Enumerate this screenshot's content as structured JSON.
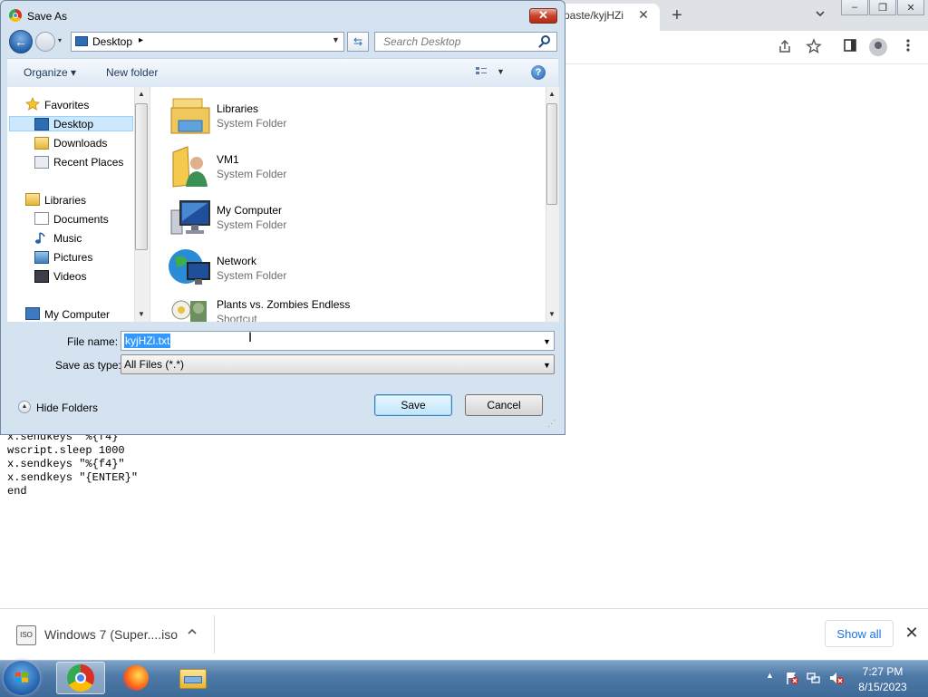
{
  "browser": {
    "tab_title": "paste/kyjHZi",
    "tab_close": "✕",
    "new_tab": "+",
    "window_buttons": [
      "–",
      "❐",
      "✕"
    ]
  },
  "page": {
    "code_lines": [
      "x.sendkeys \"%{f4}\"",
      "wscript.sleep 1000",
      "x.sendkeys \"%{f4}\"",
      "x.sendkeys \"{ENTER}\"",
      "end"
    ]
  },
  "download_shelf": {
    "item_icon_text": "ISO",
    "item_name": "Windows 7 (Super....iso",
    "show_all": "Show all",
    "close": "✕"
  },
  "dialog": {
    "title": "Save As",
    "close": "✕",
    "address": {
      "location": "Desktop",
      "separator": "▸"
    },
    "search_placeholder": "Search Desktop",
    "toolbar": {
      "organize": "Organize ▾",
      "new_folder": "New folder",
      "help": "?"
    },
    "nav": {
      "favorites": "Favorites",
      "favorites_items": [
        "Desktop",
        "Downloads",
        "Recent Places"
      ],
      "libraries": "Libraries",
      "libraries_items": [
        "Documents",
        "Music",
        "Pictures",
        "Videos"
      ],
      "computer": "My Computer"
    },
    "files": [
      {
        "name": "Libraries",
        "type": "System Folder"
      },
      {
        "name": "VM1",
        "type": "System Folder"
      },
      {
        "name": "My Computer",
        "type": "System Folder"
      },
      {
        "name": "Network",
        "type": "System Folder"
      },
      {
        "name": "Plants vs. Zombies Endless",
        "type": "Shortcut"
      }
    ],
    "file_name_label": "File name:",
    "file_name_value": "kyjHZi.txt",
    "save_type_label": "Save as type:",
    "save_type_value": "All Files (*.*)",
    "hide_folders": "Hide Folders",
    "save_button": "Save",
    "cancel_button": "Cancel"
  },
  "taskbar": {
    "time": "7:27 PM",
    "date": "8/15/2023"
  },
  "colors": {
    "selection": "#3399ff",
    "taskbar": "#4f7aa8",
    "dialog_frame": "#d5e3f1"
  }
}
